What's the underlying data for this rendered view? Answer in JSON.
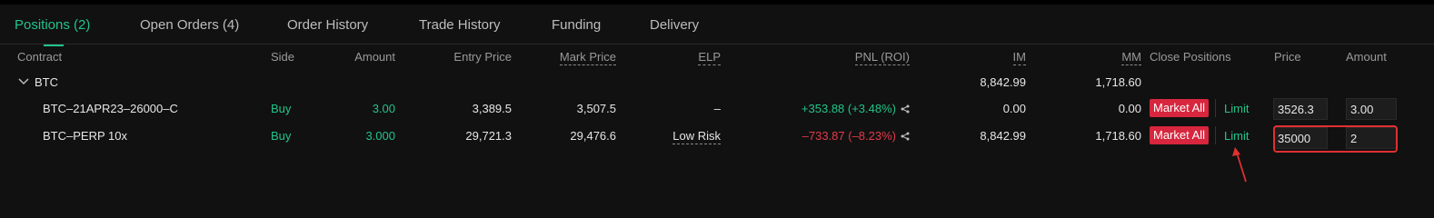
{
  "tabs": [
    {
      "label": "Positions (2)",
      "active": true
    },
    {
      "label": "Open Orders (4)",
      "active": false
    },
    {
      "label": "Order History",
      "active": false
    },
    {
      "label": "Trade History",
      "active": false
    },
    {
      "label": "Funding",
      "active": false
    },
    {
      "label": "Delivery",
      "active": false
    }
  ],
  "columns": {
    "contract": "Contract",
    "side": "Side",
    "amount": "Amount",
    "entry_price": "Entry Price",
    "mark_price": "Mark Price",
    "elp": "ELP",
    "pnl": "PNL (ROI)",
    "im": "IM",
    "mm": "MM",
    "close_positions": "Close Positions",
    "price": "Price",
    "close_amount": "Amount"
  },
  "group": {
    "name": "BTC",
    "im": "8,842.99",
    "mm": "1,718.60"
  },
  "rows": [
    {
      "contract": "BTC–21APR23–26000–C",
      "side": "Buy",
      "amount": "3.00",
      "entry_price": "3,389.5",
      "mark_price": "3,507.5",
      "elp": "–",
      "pnl": "+353.88 (+3.48%)",
      "im": "0.00",
      "mm": "0.00",
      "market_all": "Market All",
      "limit": "Limit",
      "price_value": "3526.3",
      "amount_value": "3.00"
    },
    {
      "contract": "BTC–PERP 10x",
      "side": "Buy",
      "amount": "3.000",
      "entry_price": "29,721.3",
      "mark_price": "29,476.6",
      "elp": "Low Risk",
      "pnl": "–733.87 (–8.23%)",
      "im": "8,842.99",
      "mm": "1,718.60",
      "market_all": "Market All",
      "limit": "Limit",
      "price_value": "35000",
      "amount_value": "2"
    }
  ],
  "colors": {
    "accent": "#22c38a",
    "danger": "#d7263d",
    "negative": "#e23a4a",
    "highlight": "#e03030",
    "background": "#111111"
  },
  "icons": [
    "chevron-down-icon",
    "share-icon",
    "arrow-annotation-icon"
  ]
}
